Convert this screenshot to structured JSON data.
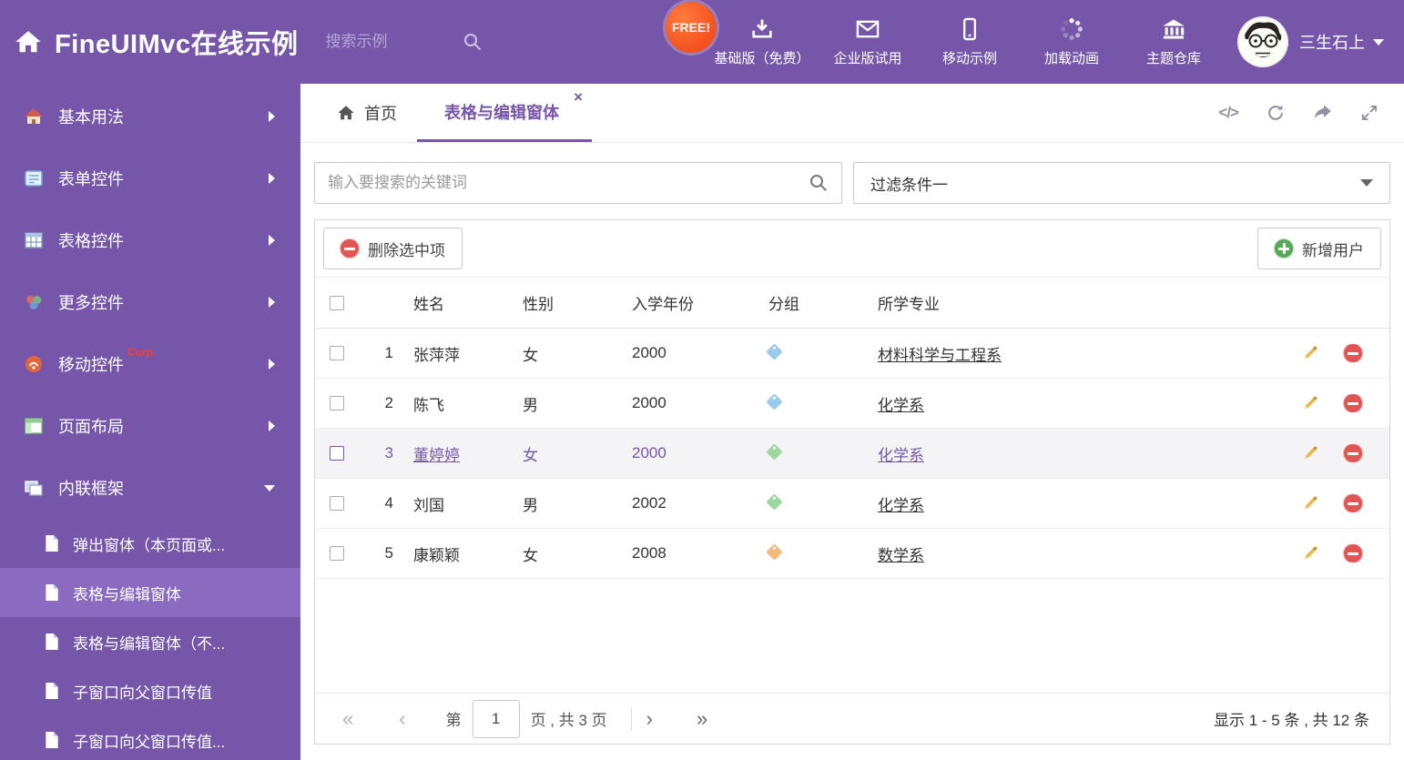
{
  "colors": {
    "purple": "#7656A8",
    "badge_orange": "#F4511E",
    "selected_row_bg": "#f4f4f6"
  },
  "header": {
    "title": "FineUIMvc在线示例",
    "search_placeholder": "搜索示例",
    "free_badge": "FREE!",
    "nav": [
      {
        "label": "基础版（免费）",
        "icon": "download-icon"
      },
      {
        "label": "企业版试用",
        "icon": "envelope-icon"
      },
      {
        "label": "移动示例",
        "icon": "mobile-icon"
      },
      {
        "label": "加载动画",
        "icon": "spinner-icon"
      },
      {
        "label": "主题仓库",
        "icon": "bank-icon"
      }
    ],
    "username": "三生石上"
  },
  "sidebar": {
    "items": [
      {
        "label": "基本用法",
        "icon": "home-icon"
      },
      {
        "label": "表单控件",
        "icon": "form-icon"
      },
      {
        "label": "表格控件",
        "icon": "table-icon"
      },
      {
        "label": "更多控件",
        "icon": "more-icon"
      },
      {
        "label": "移动控件",
        "icon": "mobile-icon",
        "badge": "Corp."
      },
      {
        "label": "页面布局",
        "icon": "layout-icon"
      },
      {
        "label": "内联框架",
        "icon": "frame-icon",
        "expanded": true
      }
    ],
    "subitems": [
      {
        "label": "弹出窗体（本页面或..."
      },
      {
        "label": "表格与编辑窗体",
        "active": true
      },
      {
        "label": "表格与编辑窗体（不..."
      },
      {
        "label": "子窗口向父窗口传值"
      },
      {
        "label": "子窗口向父窗口传值..."
      }
    ]
  },
  "tabs": {
    "home": "首页",
    "active": "表格与编辑窗体"
  },
  "filter": {
    "search_placeholder": "输入要搜索的关键词",
    "dropdown_value": "过滤条件一"
  },
  "toolbar": {
    "delete_label": "删除选中项",
    "add_label": "新增用户"
  },
  "table": {
    "columns": {
      "name": "姓名",
      "gender": "性别",
      "year": "入学年份",
      "group": "分组",
      "major": "所学专业"
    },
    "rows": [
      {
        "num": "1",
        "name": "张萍萍",
        "gender": "女",
        "year": "2000",
        "tag_color": "#9bcbec",
        "major": "材料科学与工程系"
      },
      {
        "num": "2",
        "name": "陈飞",
        "gender": "男",
        "year": "2000",
        "tag_color": "#9bcbec",
        "major": "化学系"
      },
      {
        "num": "3",
        "name": "董婷婷",
        "gender": "女",
        "year": "2000",
        "tag_color": "#9fd89f",
        "major": "化学系",
        "selected": true
      },
      {
        "num": "4",
        "name": "刘国",
        "gender": "男",
        "year": "2002",
        "tag_color": "#9fd89f",
        "major": "化学系"
      },
      {
        "num": "5",
        "name": "康颖颖",
        "gender": "女",
        "year": "2008",
        "tag_color": "#f4b97f",
        "major": "数学系"
      }
    ]
  },
  "pager": {
    "prefix": "第",
    "page": "1",
    "suffix": "页 , 共 3 页",
    "summary": "显示 1 - 5 条 , 共 12 条"
  },
  "icons": {
    "close": "×",
    "code": "</>",
    "first": "«",
    "prev": "‹",
    "next": "›",
    "last": "»"
  }
}
